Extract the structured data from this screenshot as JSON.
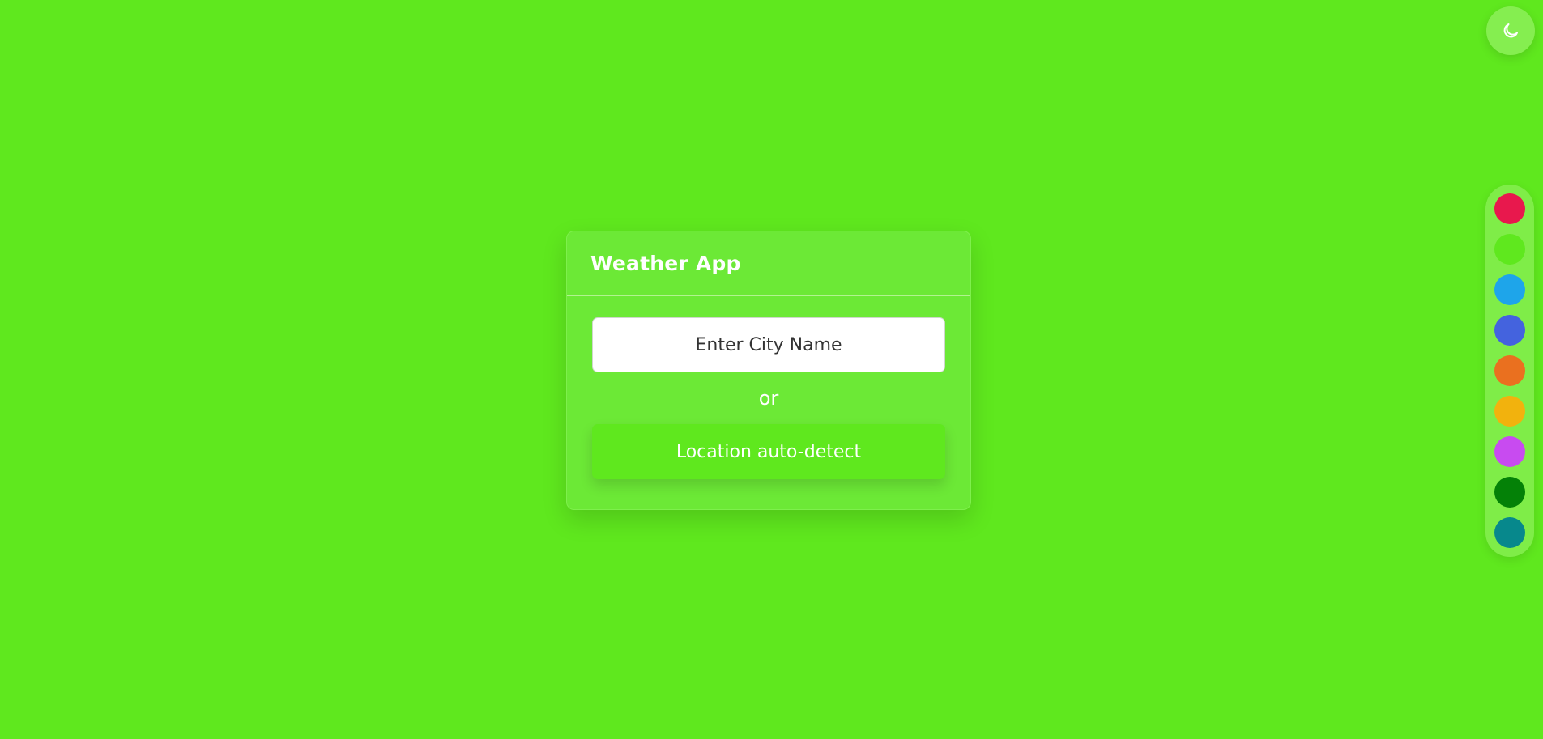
{
  "theme_toggle": {
    "icon": "moon-icon"
  },
  "card": {
    "title": "Weather App",
    "city_input": {
      "placeholder": "Enter City Name",
      "value": ""
    },
    "separator_text": "or",
    "locate_button_label": "Location auto-detect"
  },
  "colors": {
    "background": "#5fe81e",
    "card": "#6ce936",
    "accent": "#5fe81e"
  },
  "palette": {
    "swatches": [
      {
        "name": "red",
        "color": "#e8184d"
      },
      {
        "name": "lime",
        "color": "#5fe81e"
      },
      {
        "name": "sky-blue",
        "color": "#1ea5ea"
      },
      {
        "name": "royal-blue",
        "color": "#4463de"
      },
      {
        "name": "orange",
        "color": "#ea701f"
      },
      {
        "name": "amber",
        "color": "#f2b20d"
      },
      {
        "name": "purple",
        "color": "#c84bf0"
      },
      {
        "name": "green",
        "color": "#048107"
      },
      {
        "name": "teal",
        "color": "#07888c"
      }
    ]
  }
}
